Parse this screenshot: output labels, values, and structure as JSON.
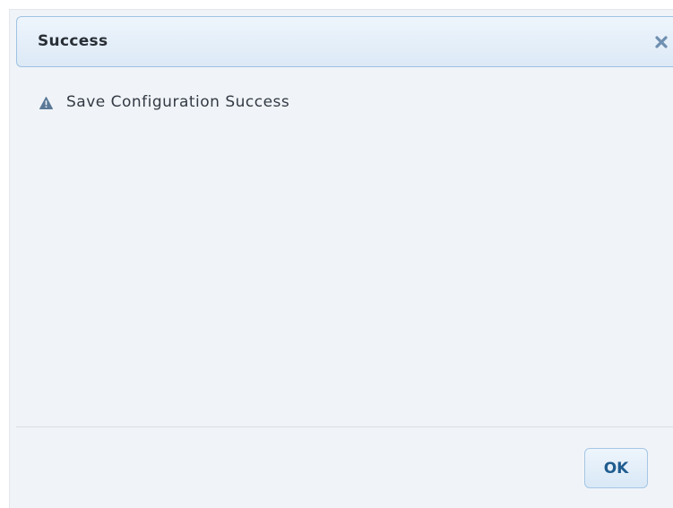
{
  "dialog": {
    "title": "Success",
    "close_icon": "close-icon",
    "message_icon": "warning-triangle-icon",
    "message": "Save Configuration Success",
    "ok_label": "OK"
  },
  "colors": {
    "title_bar_border": "#9fc2e4",
    "title_bar_bg": "#dce9f6",
    "dialog_bg": "#f0f4f8",
    "icon_color": "#5b7997",
    "ok_text": "#1f5c8f"
  }
}
